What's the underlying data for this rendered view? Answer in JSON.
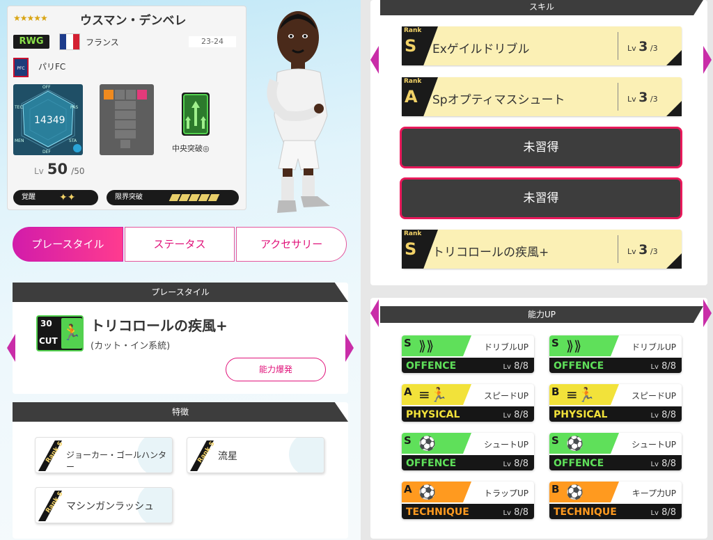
{
  "player": {
    "stars": "★★★★★",
    "name": "ウスマン・デンベレ",
    "position": "RWG",
    "country": "フランス",
    "season": "23-24",
    "club": "パリFC",
    "radar": {
      "off": "OFF",
      "pas": "PAS",
      "tec": "TEC",
      "men": "MEN",
      "def": "DEF",
      "sta": "STA",
      "value": "14349"
    },
    "tactic_label": "中央突破◎",
    "level_prefix": "Lv",
    "level": "50",
    "level_max": "/50",
    "awaken_label": "覚醒",
    "limit_break_label": "限界突破",
    "limit_break_level": 5,
    "colors": {
      "flag_blue": "#1e3c8c",
      "flag_white": "#ffffff",
      "flag_red": "#d42032"
    }
  },
  "tabs": [
    {
      "label": "プレースタイル",
      "active": true
    },
    {
      "label": "ステータス",
      "active": false
    },
    {
      "label": "アクセサリー",
      "active": false
    }
  ],
  "playstyle": {
    "header": "プレースタイル",
    "icon_num": "30",
    "icon_tag": "CUT",
    "title": "トリコロールの疾風+",
    "subtitle": "(カット・イン系統)",
    "burst_button": "能力爆発"
  },
  "traits": {
    "header": "特徴",
    "rank_text": "Rank S",
    "items": [
      "ジョーカー・ゴールハンター",
      "流星",
      "マシンガンラッシュ"
    ]
  },
  "skills": {
    "header": "スキル",
    "rank_label": "Rank",
    "lv_prefix": "Lv",
    "items": [
      {
        "rank": "S",
        "name": "Exゲイルドリブル",
        "lv": "3",
        "max": "/3"
      },
      {
        "rank": "A",
        "name": "Spオプティマスシュート",
        "lv": "3",
        "max": "/3"
      },
      {
        "locked": "未習得"
      },
      {
        "locked": "未習得"
      },
      {
        "rank": "S",
        "name": "トリコロールの疾風+",
        "lv": "3",
        "max": "/3"
      }
    ]
  },
  "ability_up": {
    "header": "能力UP",
    "lv_prefix": "Lv",
    "items": [
      {
        "rank": "S",
        "name": "ドリブルUP",
        "category": "OFFENCE",
        "lv": "8/8",
        "color": "#5fe05a",
        "icon": "dribble-icon",
        "glyph": "⟫⟫"
      },
      {
        "rank": "S",
        "name": "ドリブルUP",
        "category": "OFFENCE",
        "lv": "8/8",
        "color": "#5fe05a",
        "icon": "dribble-icon",
        "glyph": "⟫⟫"
      },
      {
        "rank": "A",
        "name": "スピードUP",
        "category": "PHYSICAL",
        "lv": "8/8",
        "color": "#f2e23a",
        "icon": "speed-icon",
        "glyph": "≡🏃"
      },
      {
        "rank": "B",
        "name": "スピードUP",
        "category": "PHYSICAL",
        "lv": "8/8",
        "color": "#f2e23a",
        "icon": "speed-icon",
        "glyph": "≡🏃"
      },
      {
        "rank": "S",
        "name": "シュートUP",
        "category": "OFFENCE",
        "lv": "8/8",
        "color": "#5fe05a",
        "icon": "shoot-icon",
        "glyph": "⚽"
      },
      {
        "rank": "S",
        "name": "シュートUP",
        "category": "OFFENCE",
        "lv": "8/8",
        "color": "#5fe05a",
        "icon": "shoot-icon",
        "glyph": "⚽"
      },
      {
        "rank": "A",
        "name": "トラップUP",
        "category": "TECHNIQUE",
        "lv": "8/8",
        "color": "#ff9a1f",
        "icon": "trap-icon",
        "glyph": "⚽"
      },
      {
        "rank": "B",
        "name": "キープ力UP",
        "category": "TECHNIQUE",
        "lv": "8/8",
        "color": "#ff9a1f",
        "icon": "keep-icon",
        "glyph": "⚽"
      }
    ]
  }
}
